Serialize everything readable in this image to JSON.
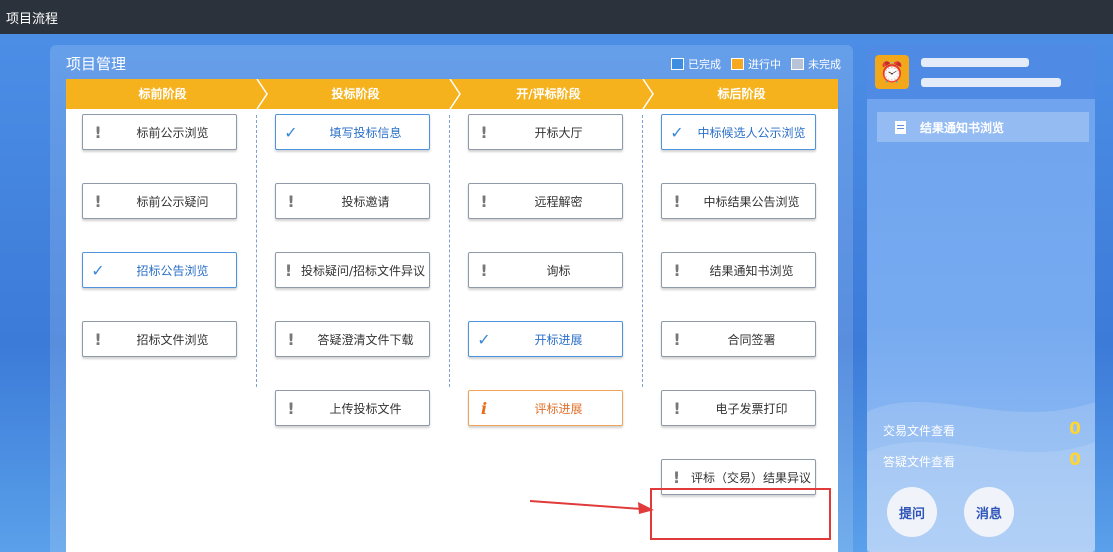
{
  "app": {
    "title": "项目流程"
  },
  "panel": {
    "title": "项目管理"
  },
  "legend": [
    {
      "label": "已完成",
      "color": "#3d8ee0"
    },
    {
      "label": "进行中",
      "color": "#f5a820"
    },
    {
      "label": "未完成",
      "color": "#b8c4d6"
    }
  ],
  "stages": [
    "标前阶段",
    "投标阶段",
    "开/评标阶段",
    "标后阶段"
  ],
  "columns": [
    [
      {
        "label": "标前公示浏览",
        "status": "pending"
      },
      {
        "label": "标前公示疑问",
        "status": "pending"
      },
      {
        "label": "招标公告浏览",
        "status": "done"
      },
      {
        "label": "招标文件浏览",
        "status": "pending"
      }
    ],
    [
      {
        "label": "填写投标信息",
        "status": "done"
      },
      {
        "label": "投标邀请",
        "status": "pending"
      },
      {
        "label": "投标疑问/招标文件异议",
        "status": "pending"
      },
      {
        "label": "答疑澄清文件下载",
        "status": "pending"
      },
      {
        "label": "上传投标文件",
        "status": "pending"
      }
    ],
    [
      {
        "label": "开标大厅",
        "status": "pending"
      },
      {
        "label": "远程解密",
        "status": "pending"
      },
      {
        "label": "询标",
        "status": "pending"
      },
      {
        "label": "开标进展",
        "status": "done"
      },
      {
        "label": "评标进展",
        "status": "progress"
      }
    ],
    [
      {
        "label": "中标候选人公示浏览",
        "status": "done"
      },
      {
        "label": "中标结果公告浏览",
        "status": "pending"
      },
      {
        "label": "结果通知书浏览",
        "status": "pending"
      },
      {
        "label": "合同签署",
        "status": "pending"
      },
      {
        "label": "电子发票打印",
        "status": "pending"
      },
      {
        "label": "评标（交易）结果异议",
        "status": "pending"
      }
    ]
  ],
  "icons": {
    "pending": "!",
    "done": "✓",
    "progress": "i"
  },
  "sidebar": {
    "link": "结果通知书浏览",
    "stats": [
      {
        "label": "交易文件查看",
        "value": "0"
      },
      {
        "label": "答疑文件查看",
        "value": "0"
      }
    ],
    "buttons": [
      "提问",
      "消息"
    ]
  }
}
